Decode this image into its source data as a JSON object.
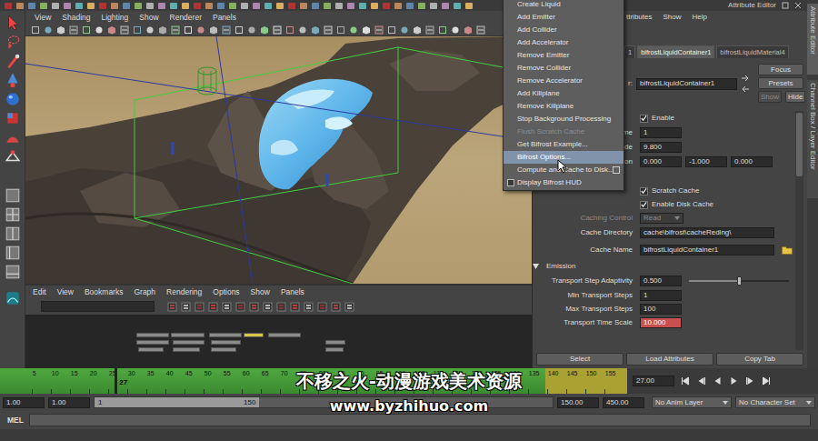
{
  "viewport": {
    "menu": [
      "View",
      "Shading",
      "Lighting",
      "Show",
      "Renderer",
      "Panels"
    ]
  },
  "node_editor": {
    "menu": [
      "Edit",
      "View",
      "Bookmarks",
      "Graph",
      "Rendering",
      "Options",
      "Show",
      "Panels"
    ]
  },
  "bifrost_menu": {
    "items": [
      {
        "kind": "item",
        "label": "Create Liquid",
        "disabled": false,
        "selected": false
      },
      {
        "kind": "item",
        "label": "Add Emitter",
        "disabled": false,
        "selected": false
      },
      {
        "kind": "item",
        "label": "Add Collider",
        "disabled": false,
        "selected": false
      },
      {
        "kind": "item",
        "label": "Add Accelerator",
        "disabled": false,
        "selected": false
      },
      {
        "kind": "item",
        "label": "Remove Emitter",
        "disabled": false,
        "selected": false
      },
      {
        "kind": "item",
        "label": "Remove Collider",
        "disabled": false,
        "selected": false
      },
      {
        "kind": "item",
        "label": "Remove Accelerator",
        "disabled": false,
        "selected": false
      },
      {
        "kind": "item",
        "label": "Add Killplane",
        "disabled": false,
        "selected": false
      },
      {
        "kind": "item",
        "label": "Remove Killplane",
        "disabled": false,
        "selected": false
      },
      {
        "kind": "item",
        "label": "Stop Background Processing",
        "disabled": false,
        "selected": false
      },
      {
        "kind": "item",
        "label": "Flush Scratch Cache",
        "disabled": true,
        "selected": false
      },
      {
        "kind": "item",
        "label": "Get Bifrost Example...",
        "disabled": false,
        "selected": false
      },
      {
        "kind": "item",
        "label": "Bifrost Options...",
        "disabled": false,
        "selected": true
      },
      {
        "kind": "option",
        "label": "Compute and Cache to Disk...",
        "disabled": false,
        "selected": false
      },
      {
        "kind": "check",
        "label": "Display Bifrost HUD",
        "disabled": false,
        "selected": false,
        "checked": false
      }
    ]
  },
  "attribute_editor": {
    "title": "Attribute Editor",
    "menu": [
      "ttributes",
      "Show",
      "Help"
    ],
    "tabs": [
      {
        "label": "1",
        "selected": false
      },
      {
        "label": "bifrostLiquidContainer1",
        "selected": true
      },
      {
        "label": "bifrostLiquidMaterial4",
        "selected": false
      }
    ],
    "name_label": "r:",
    "name_value": "bifrostLiquidContainer1",
    "buttons": [
      {
        "label": "Focus",
        "disabled": false
      },
      {
        "label": "Presets",
        "disabled": false
      },
      {
        "label": "Show",
        "disabled": true
      },
      {
        "label": "Hide",
        "disabled": false
      }
    ],
    "rows": [
      {
        "kind": "check",
        "label": "Enable",
        "checked": true
      },
      {
        "kind": "field",
        "label": "me",
        "values": [
          "1"
        ]
      },
      {
        "kind": "field",
        "label": "de",
        "values": [
          "9.800"
        ]
      },
      {
        "kind": "field",
        "label": "on",
        "values": [
          "0.000",
          "-1.000",
          "0.000"
        ]
      },
      {
        "kind": "section",
        "expanded": true
      },
      {
        "kind": "check",
        "label": "Scratch Cache",
        "checked": true
      },
      {
        "kind": "check",
        "label": "Enable Disk Cache",
        "checked": true
      },
      {
        "kind": "select",
        "label": "Caching Control",
        "value": "Read",
        "disabled": true
      },
      {
        "kind": "text",
        "label": "Cache Directory",
        "value": "cache\\bifrost\\cacheReding\\",
        "browse": false
      },
      {
        "kind": "text",
        "label": "Cache Name",
        "value": "bifrostLiquidContainer1",
        "browse": true
      },
      {
        "kind": "section",
        "label": "Emission",
        "expanded": true
      },
      {
        "kind": "slider",
        "label": "Transport Step Adaptivity",
        "values": [
          "0.500"
        ],
        "level": 0.5
      },
      {
        "kind": "field",
        "label": "Min Transport Steps",
        "values": [
          "1"
        ]
      },
      {
        "kind": "field",
        "label": "Max Transport Steps",
        "values": [
          "100"
        ]
      },
      {
        "kind": "field",
        "label": "Transport Time Scale",
        "values": [
          "10.000"
        ],
        "keyed": true
      }
    ],
    "bottom_buttons": [
      "Select",
      "Load Attributes",
      "Copy Tab"
    ]
  },
  "side_tabs": [
    {
      "label": "Attribute Editor",
      "selected": true
    },
    {
      "label": "Channel Box / Layer Editor",
      "selected": false
    }
  ],
  "timeline": {
    "ticks": [
      "5",
      "10",
      "15",
      "20",
      "25",
      "30",
      "35",
      "40",
      "45",
      "50",
      "55",
      "60",
      "65",
      "70",
      "75",
      "80",
      "85",
      "90",
      "95",
      "100",
      "105",
      "110",
      "115",
      "120",
      "125",
      "130",
      "135",
      "140",
      "145",
      "150",
      "155"
    ],
    "current": "27",
    "current_field": "27.00",
    "level": 0.87
  },
  "range": {
    "start": "1.00",
    "inner_start": "1.00",
    "bar_start": "1",
    "bar_end": "150",
    "inner_end": "150.00",
    "end": "450.00",
    "level": 0.36,
    "anim_layer": "No Anim Layer",
    "character_set": "No Character Set"
  },
  "command_line": {
    "label": "MEL"
  },
  "watermark": {
    "lines": [
      "不移之火-动漫游戏美术资源",
      "www.byzhihuo.com"
    ]
  }
}
